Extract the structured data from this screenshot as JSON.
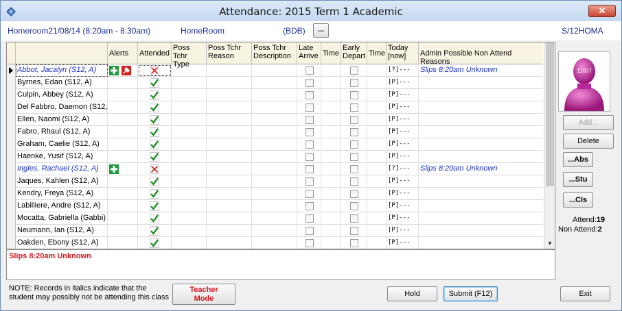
{
  "window": {
    "title": "Attendance:  2015 Term 1 Academic",
    "close_glyph": "✕"
  },
  "header": {
    "session": "Homeroom21/08/14 (8:20am - 8:30am)",
    "class": "HomeRoom",
    "teacher_code": "(BDB)",
    "more_label": "...",
    "group": "S/12HOMA"
  },
  "grid": {
    "columns": {
      "alerts": "Alerts",
      "attended": "Attended",
      "poss_tchr_type": "Poss Tchr Type",
      "poss_tchr_reason": "Poss Tchr Reason",
      "poss_tchr_desc": "Poss Tchr Description",
      "late_arrive": "Late Arrive",
      "time1": "Time",
      "early_depart": "Early Depart",
      "time2": "Time",
      "today": "Today [now]",
      "admin": "Admin Possible Non Attend Reasons"
    },
    "rows": [
      {
        "name": "Abbot, Jacalyn (S12, A)",
        "italic": true,
        "alerts": [
          "medical",
          "tool"
        ],
        "attended": false,
        "today": "[?]---",
        "reason": "Slips 8:20am Unknown",
        "selected": true
      },
      {
        "name": "Byrnes, Edan (S12, A)",
        "italic": false,
        "alerts": [],
        "attended": true,
        "today": "[P]---",
        "reason": ""
      },
      {
        "name": "Culpin, Abbey (S12, A)",
        "italic": false,
        "alerts": [],
        "attended": true,
        "today": "[P]---",
        "reason": ""
      },
      {
        "name": "Del Fabbro, Daemon (S12,",
        "italic": false,
        "alerts": [],
        "attended": true,
        "today": "[P]---",
        "reason": ""
      },
      {
        "name": "Ellen, Naomi (S12, A)",
        "italic": false,
        "alerts": [],
        "attended": true,
        "today": "[P]---",
        "reason": ""
      },
      {
        "name": "Fabro, Rhaul (S12, A)",
        "italic": false,
        "alerts": [],
        "attended": true,
        "today": "[P]---",
        "reason": ""
      },
      {
        "name": "Graham, Caelie (S12, A)",
        "italic": false,
        "alerts": [],
        "attended": true,
        "today": "[P]---",
        "reason": ""
      },
      {
        "name": "Haenke, Yusif (S12, A)",
        "italic": false,
        "alerts": [],
        "attended": true,
        "today": "[P]---",
        "reason": ""
      },
      {
        "name": "Ingles, Rachael (S12, A)",
        "italic": true,
        "alerts": [
          "medical"
        ],
        "attended": false,
        "today": "[?]---",
        "reason": "Slips 8:20am Unknown"
      },
      {
        "name": "Jaques, Kahlen (S12, A)",
        "italic": false,
        "alerts": [],
        "attended": true,
        "today": "[P]---",
        "reason": ""
      },
      {
        "name": "Kendry, Freya (S12, A)",
        "italic": false,
        "alerts": [],
        "attended": true,
        "today": "[P]---",
        "reason": ""
      },
      {
        "name": "Labilliere, Andre (S12, A)",
        "italic": false,
        "alerts": [],
        "attended": true,
        "today": "[P]---",
        "reason": ""
      },
      {
        "name": "Mocatta, Gabriella (Gabbi)",
        "italic": false,
        "alerts": [],
        "attended": true,
        "today": "[P]---",
        "reason": ""
      },
      {
        "name": "Neumann, Ian (S12, A)",
        "italic": false,
        "alerts": [],
        "attended": true,
        "today": "[P]---",
        "reason": ""
      },
      {
        "name": "Oakden, Ebony (S12, A)",
        "italic": false,
        "alerts": [],
        "attended": true,
        "today": "[P]---",
        "reason": ""
      }
    ]
  },
  "status": {
    "message": "Slips 8:20am Unknown"
  },
  "footer": {
    "note_line1": "NOTE:  Records in italics indicate that the",
    "note_line2": "student may possibly not be attending this class",
    "teacher_mode_line1": "Teacher",
    "teacher_mode_line2": "Mode",
    "hold_label": "Hold",
    "submit_label": "Submit (F12)",
    "exit_label": "Exit"
  },
  "side": {
    "avatar_tag": "11007",
    "add_label": "Add...",
    "delete_label": "Delete",
    "abs_label": "...Abs",
    "stu_label": "...Stu",
    "cls_label": "...Cls",
    "attend_label": "Attend:",
    "attend_count": "19",
    "non_attend_label": "Non Attend:",
    "non_attend_count": "2"
  },
  "colors": {
    "link_blue": "#1a2fc8",
    "alert_red": "#d4141c",
    "header_fill": "#f9f4e2",
    "check_green": "#1f8f22"
  }
}
